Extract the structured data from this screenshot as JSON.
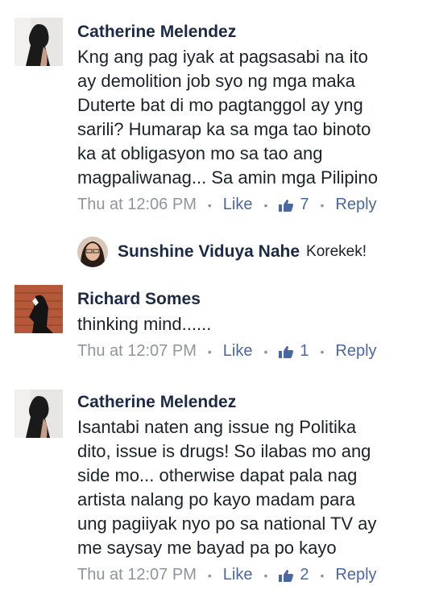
{
  "comments": [
    {
      "name": "Catherine Melendez",
      "lines": [
        "Kng ang pag iyak at pagsasabi na ito",
        "ay demolition job syo ng mga maka",
        "Duterte bat di mo pagtanggol ay yng",
        "sarili? Humarap ka sa mga tao binoto",
        "ka at obligasyon mo sa tao ang",
        "magpaliwanag... Sa amin mga Pilipino"
      ],
      "time": "Thu at 12:06 PM",
      "like_label": "Like",
      "like_count": "7",
      "reply_label": "Reply",
      "reply": {
        "name": "Sunshine Viduya Nahe",
        "text": "Korekek!"
      }
    },
    {
      "name": "Richard Somes",
      "lines": [
        "thinking mind......"
      ],
      "time": "Thu at 12:07 PM",
      "like_label": "Like",
      "like_count": "1",
      "reply_label": "Reply"
    },
    {
      "name": "Catherine Melendez",
      "lines": [
        "Isantabi naten ang issue ng Politika",
        "dito, issue is drugs! So ilabas mo ang",
        "side mo... otherwise dapat pala nag",
        "artista nalang po kayo madam para",
        "ung pagiiyak nyo po sa national TV ay",
        "me saysay me bayad pa po kayo"
      ],
      "time": "Thu at 12:07 PM",
      "like_label": "Like",
      "like_count": "2",
      "reply_label": "Reply"
    }
  ],
  "separator": "•",
  "icons": {
    "thumbs_up": "thumbs-up-icon"
  },
  "colors": {
    "name": "#1c2a48",
    "link": "#4b67a1",
    "meta": "#90949c"
  }
}
